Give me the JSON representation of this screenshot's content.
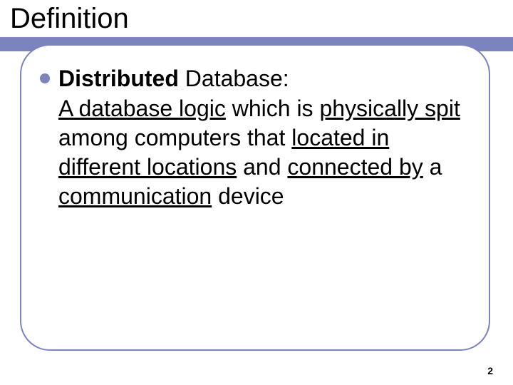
{
  "slide": {
    "title": "Definition",
    "bullet": {
      "term_bold": "Distributed",
      "term_rest": " Database:",
      "def_seg1_u": "A database logic",
      "def_seg2": " which is ",
      "def_seg3_u": "physically spit",
      "def_seg4": " among computers that ",
      "def_seg5_u": "located in different locations",
      "def_seg6": " and ",
      "def_seg7_u": "connected by",
      "def_seg8": " a ",
      "def_seg9_u": "communication",
      "def_seg10": " device"
    },
    "page_number": "2"
  },
  "colors": {
    "accent": "#7b84bf"
  }
}
